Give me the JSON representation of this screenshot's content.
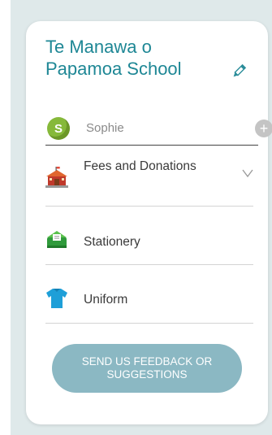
{
  "school": {
    "name": "Te Manawa o Papamoa School"
  },
  "user": {
    "initial": "S",
    "name": "Sophie"
  },
  "menu": [
    {
      "label": "Fees and Donations",
      "icon": "school-building-icon",
      "expandable": true
    },
    {
      "label": "Stationery",
      "icon": "stationery-box-icon",
      "expandable": false
    },
    {
      "label": "Uniform",
      "icon": "shirt-icon",
      "expandable": false
    }
  ],
  "feedback": {
    "label": "SEND US FEEDBACK OR SUGGESTIONS"
  },
  "colors": {
    "background": "#dfe9ea",
    "title": "#1e8795",
    "avatar": "#86b93a",
    "button": "#8bb8c3",
    "add": "#c4c4c4"
  }
}
